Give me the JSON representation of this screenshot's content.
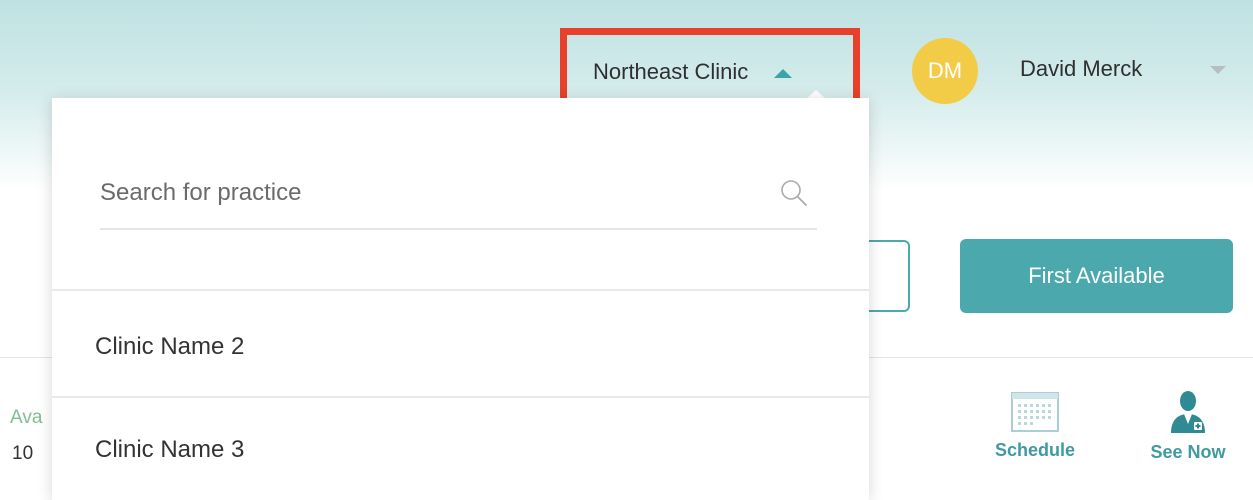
{
  "header": {
    "clinic_selector_label": "Northeast Clinic",
    "user": {
      "initials": "DM",
      "name": "David Merck"
    }
  },
  "dropdown": {
    "search_placeholder": "Search for practice",
    "items": [
      {
        "label": "Clinic Name 2"
      },
      {
        "label": "Clinic Name 3"
      }
    ]
  },
  "toolbar": {
    "first_available_label": "First Available"
  },
  "row": {
    "partial_label": "Ava",
    "partial_value": "10"
  },
  "actions": {
    "schedule_label": "Schedule",
    "see_now_label": "See Now"
  },
  "colors": {
    "accent": "#4ba8ad",
    "highlight_box": "#e8402a",
    "avatar": "#f3cc47"
  }
}
